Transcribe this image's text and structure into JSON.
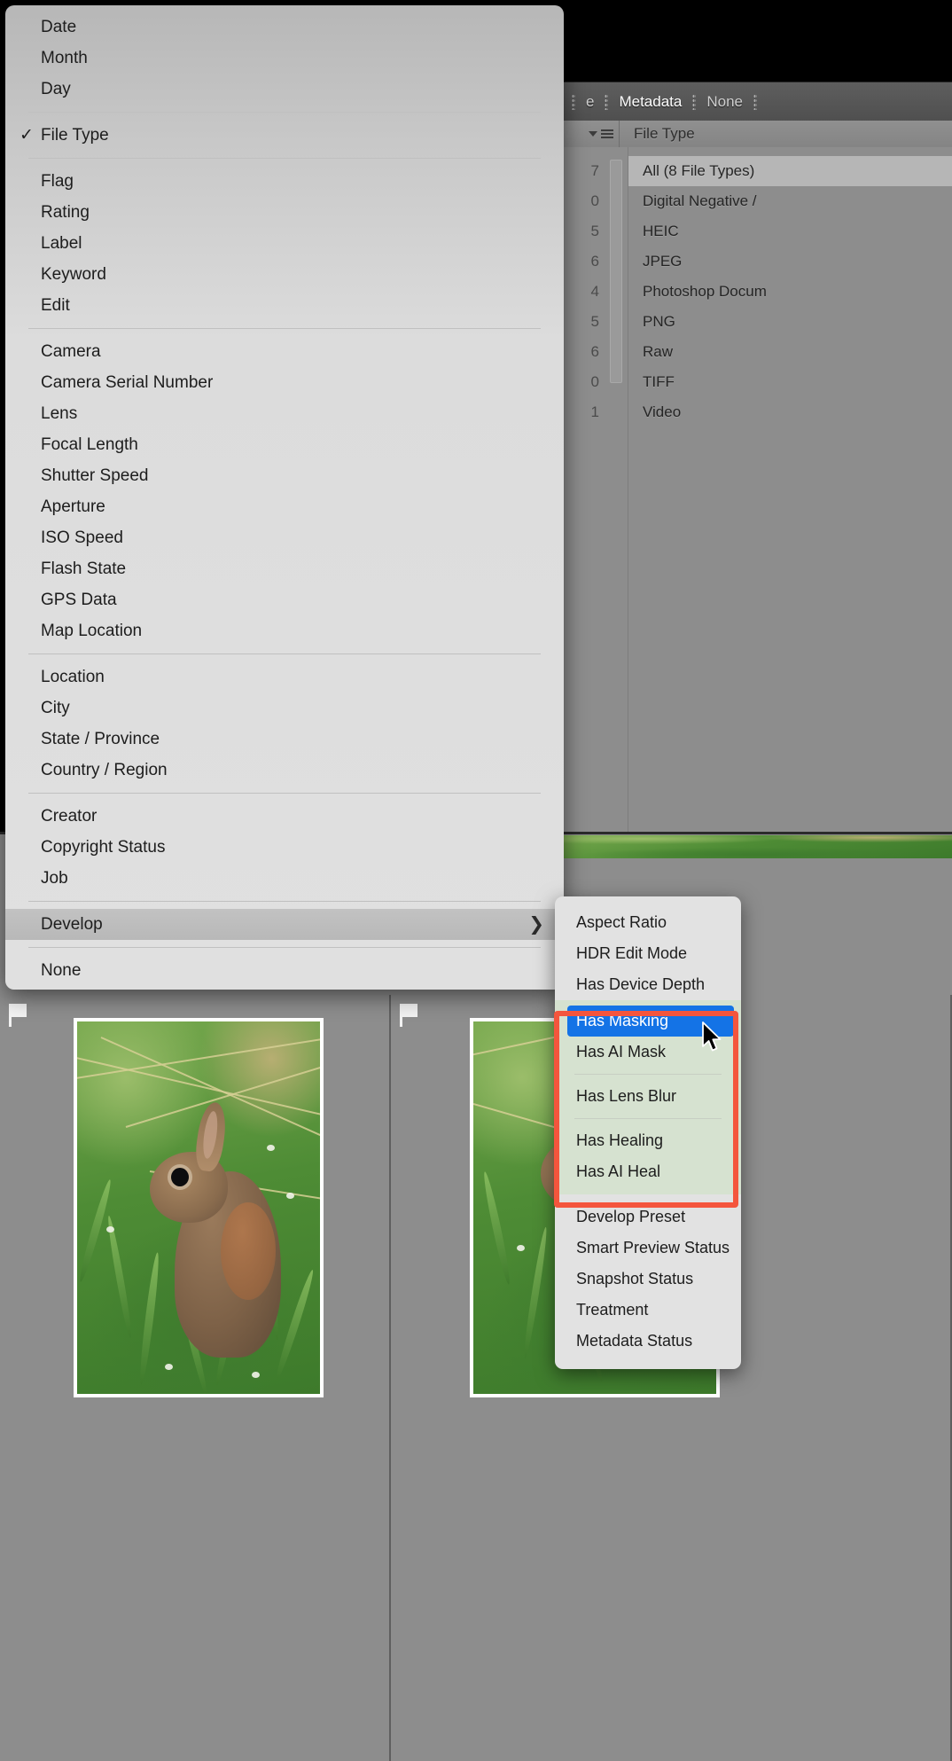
{
  "app": {
    "module_bar": {
      "items": [
        {
          "label": "e",
          "active": false
        },
        {
          "label": "Metadata",
          "active": true
        },
        {
          "label": "None",
          "active": false
        }
      ]
    },
    "column_header": {
      "title": "File Type",
      "sort_icon": "triangle-down-icon",
      "menu_icon": "hamburger-icon"
    },
    "filter_list": {
      "counts": [
        "7",
        "0",
        "5",
        "6",
        "4",
        "5",
        "6",
        "0",
        "1"
      ],
      "rows": [
        {
          "label": "All (8 File Types)",
          "selected": true
        },
        {
          "label": "Digital Negative /",
          "selected": false
        },
        {
          "label": "HEIC",
          "selected": false
        },
        {
          "label": "JPEG",
          "selected": false
        },
        {
          "label": "Photoshop Docum",
          "selected": false
        },
        {
          "label": "PNG",
          "selected": false
        },
        {
          "label": "Raw",
          "selected": false
        },
        {
          "label": "TIFF",
          "selected": false
        },
        {
          "label": "Video",
          "selected": false
        }
      ]
    },
    "grid": {
      "cells": [
        {
          "flag": "flag-icon",
          "photo_alt": "rabbit-in-grass"
        },
        {
          "flag": "flag-icon",
          "photo_alt": "rabbit-in-grass"
        }
      ]
    }
  },
  "menu": {
    "groups": [
      {
        "items": [
          {
            "label": "Date",
            "checked": false
          },
          {
            "label": "Month",
            "checked": false
          },
          {
            "label": "Day",
            "checked": false
          }
        ]
      },
      {
        "items": [
          {
            "label": "File Type",
            "checked": true
          }
        ]
      },
      {
        "items": [
          {
            "label": "Flag",
            "checked": false
          },
          {
            "label": "Rating",
            "checked": false
          },
          {
            "label": "Label",
            "checked": false
          },
          {
            "label": "Keyword",
            "checked": false
          },
          {
            "label": "Edit",
            "checked": false
          }
        ]
      },
      {
        "items": [
          {
            "label": "Camera",
            "checked": false
          },
          {
            "label": "Camera Serial Number",
            "checked": false
          },
          {
            "label": "Lens",
            "checked": false
          },
          {
            "label": "Focal Length",
            "checked": false
          },
          {
            "label": "Shutter Speed",
            "checked": false
          },
          {
            "label": "Aperture",
            "checked": false
          },
          {
            "label": "ISO Speed",
            "checked": false
          },
          {
            "label": "Flash State",
            "checked": false
          },
          {
            "label": "GPS Data",
            "checked": false
          },
          {
            "label": "Map Location",
            "checked": false
          }
        ]
      },
      {
        "items": [
          {
            "label": "Location",
            "checked": false
          },
          {
            "label": "City",
            "checked": false
          },
          {
            "label": "State / Province",
            "checked": false
          },
          {
            "label": "Country / Region",
            "checked": false
          }
        ]
      },
      {
        "items": [
          {
            "label": "Creator",
            "checked": false
          },
          {
            "label": "Copyright Status",
            "checked": false
          },
          {
            "label": "Job",
            "checked": false
          }
        ]
      },
      {
        "items": [
          {
            "label": "Develop",
            "checked": false,
            "submenu": true,
            "highlighted": true,
            "chevron": "❯"
          }
        ]
      },
      {
        "items": [
          {
            "label": "None",
            "checked": false
          }
        ]
      }
    ]
  },
  "submenu": {
    "items": [
      {
        "label": "Aspect Ratio",
        "highlighted": false,
        "in_callout": false
      },
      {
        "label": "HDR Edit Mode",
        "highlighted": false,
        "in_callout": false
      },
      {
        "label": "Has Device Depth",
        "highlighted": false,
        "in_callout": false
      },
      {
        "label": "Has Masking",
        "highlighted": true,
        "in_callout": true
      },
      {
        "label": "Has AI Mask",
        "highlighted": false,
        "in_callout": true
      },
      {
        "label": "Has Lens Blur",
        "highlighted": false,
        "in_callout": true
      },
      {
        "label": "Has Healing",
        "highlighted": false,
        "in_callout": true
      },
      {
        "label": "Has AI Heal",
        "highlighted": false,
        "in_callout": true
      },
      {
        "label": "Develop Preset",
        "highlighted": false,
        "in_callout": false
      },
      {
        "label": "Smart Preview Status",
        "highlighted": false,
        "in_callout": false
      },
      {
        "label": "Snapshot Status",
        "highlighted": false,
        "in_callout": false
      },
      {
        "label": "Treatment",
        "highlighted": false,
        "in_callout": false
      },
      {
        "label": "Metadata Status",
        "highlighted": false,
        "in_callout": false
      }
    ]
  },
  "colors": {
    "highlight_blue": "#1473E6",
    "callout_red": "#F4553D",
    "menu_bg": "#DCDCDC",
    "submenu_green": "#D6E2D0",
    "panel_gray": "#8D8D8D"
  },
  "cursor": {
    "icon": "mouse-pointer-icon"
  }
}
